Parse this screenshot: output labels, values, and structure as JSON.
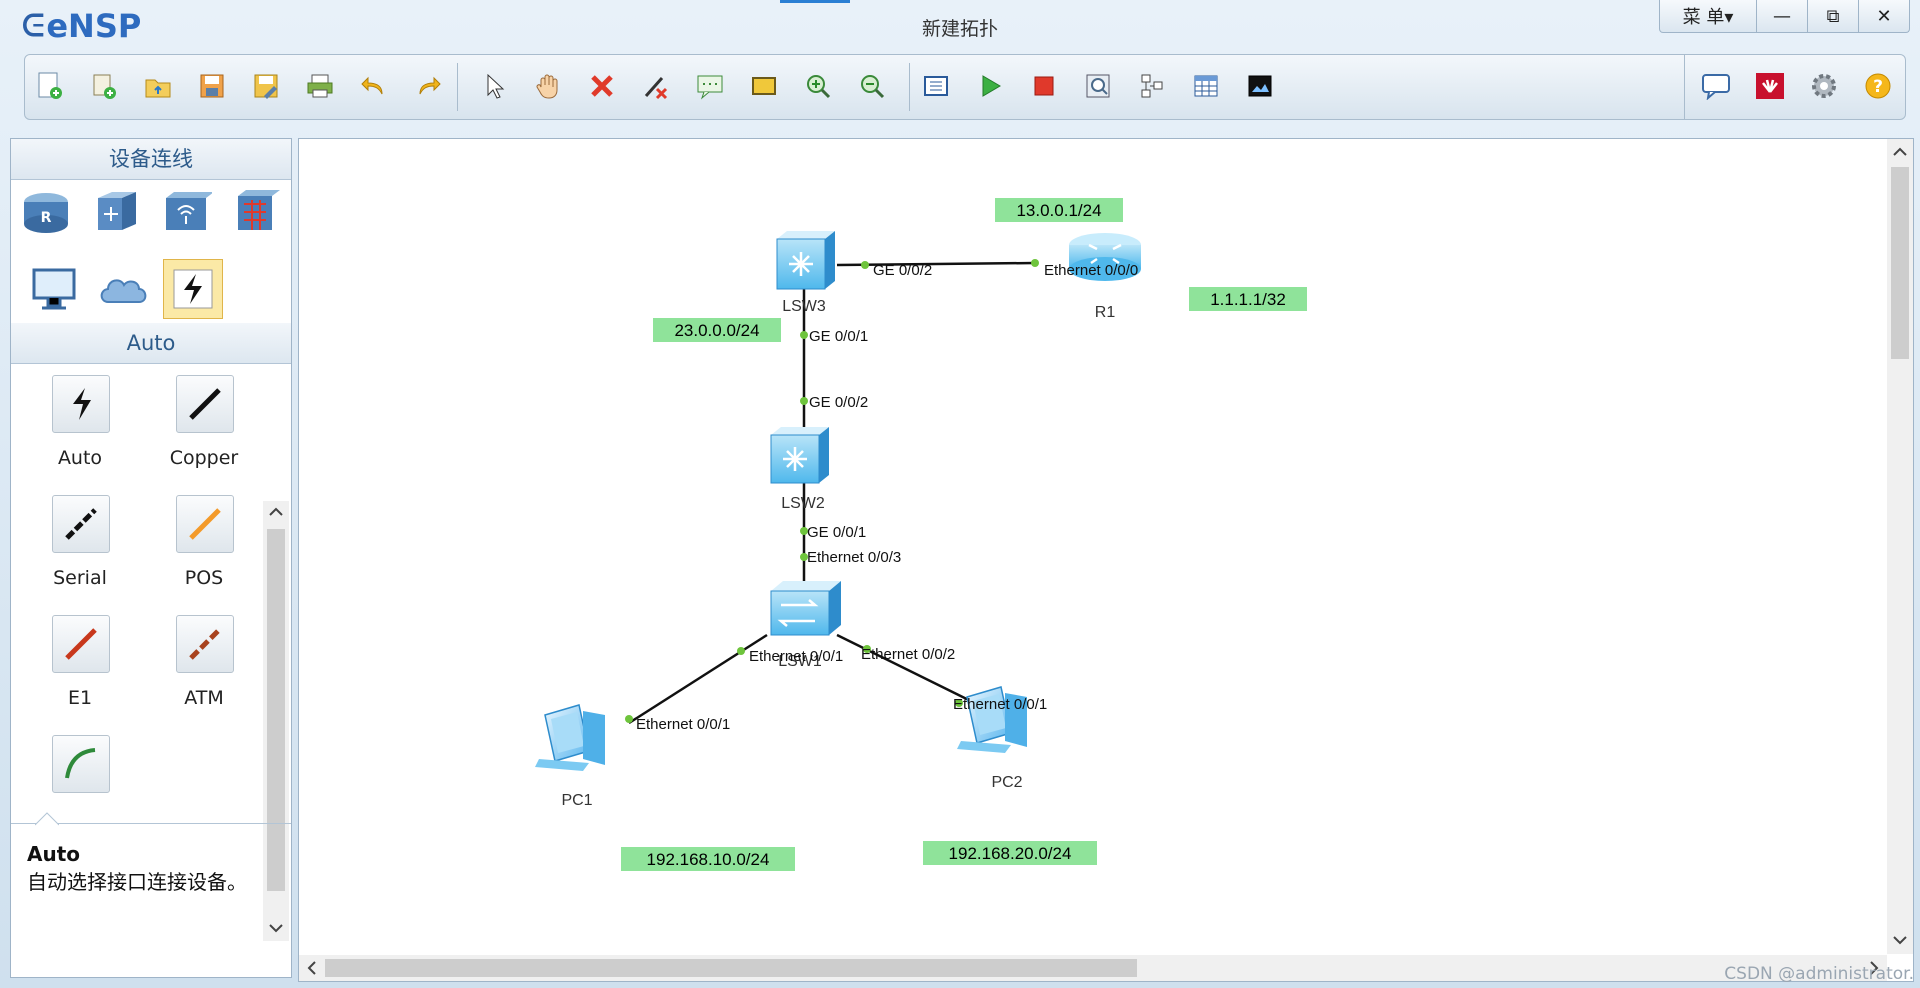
{
  "app": {
    "logo_text": "eNSP",
    "window_title": "新建拓扑",
    "menu_label": "菜 单▾"
  },
  "window_controls": {
    "minimize": "—",
    "restore": "⧉",
    "close": "✕"
  },
  "toolbar": {
    "items": [
      "new-topology",
      "new-example",
      "open",
      "save",
      "save-as",
      "print",
      "undo",
      "redo",
      "select",
      "drag",
      "delete",
      "delete-all-links",
      "text",
      "rectangle",
      "zoom-in",
      "zoom-out",
      "restore-size",
      "start-device",
      "stop-device",
      "capture",
      "show-interfaces",
      "palette",
      "collect-data"
    ],
    "right_items": [
      "feedback",
      "huawei",
      "settings",
      "help"
    ]
  },
  "left_panel": {
    "devices_title": "设备连线",
    "devices": [
      "router",
      "switch",
      "wireless",
      "firewall",
      "pc",
      "cloud",
      "cable"
    ],
    "cables_title": "Auto",
    "cables": [
      {
        "label": "Auto",
        "color": "#000000"
      },
      {
        "label": "Copper",
        "color": "#000000"
      },
      {
        "label": "Serial",
        "color": "#000000"
      },
      {
        "label": "POS",
        "color": "#f39a2a"
      },
      {
        "label": "E1",
        "color": "#c8381c"
      },
      {
        "label": "ATM",
        "color": "#a8431e"
      },
      {
        "label": "",
        "color": "#2e8a3a"
      }
    ],
    "desc_title": "Auto",
    "desc_text": "自动选择接口连接设备。"
  },
  "topology": {
    "devices": {
      "lsw3": "LSW3",
      "r1": "R1",
      "lsw2": "LSW2",
      "lsw1": "LSW1",
      "pc1": "PC1",
      "pc2": "PC2"
    },
    "ports": {
      "lsw3_ge002": "GE 0/0/2",
      "r1_eth000": "Ethernet 0/0/0",
      "lsw3_ge001": "GE 0/0/1",
      "lsw2_ge002": "GE 0/0/2",
      "lsw2_ge001": "GE 0/0/1",
      "lsw1_eth003": "Ethernet 0/0/3",
      "lsw1_eth001": "Ethernet 0/0/1",
      "lsw1_eth002": "Ethernet 0/0/2",
      "pc1_eth001": "Ethernet 0/0/1",
      "pc2_eth001": "Ethernet 0/0/1"
    },
    "networks": {
      "n13": "13.0.0.1/24",
      "n1": "1.1.1.1/32",
      "n23": "23.0.0.0/24",
      "n10": "192.168.10.0/24",
      "n20": "192.168.20.0/24"
    },
    "label_bg": "#8fe39a"
  },
  "watermark": "CSDN @administrator."
}
